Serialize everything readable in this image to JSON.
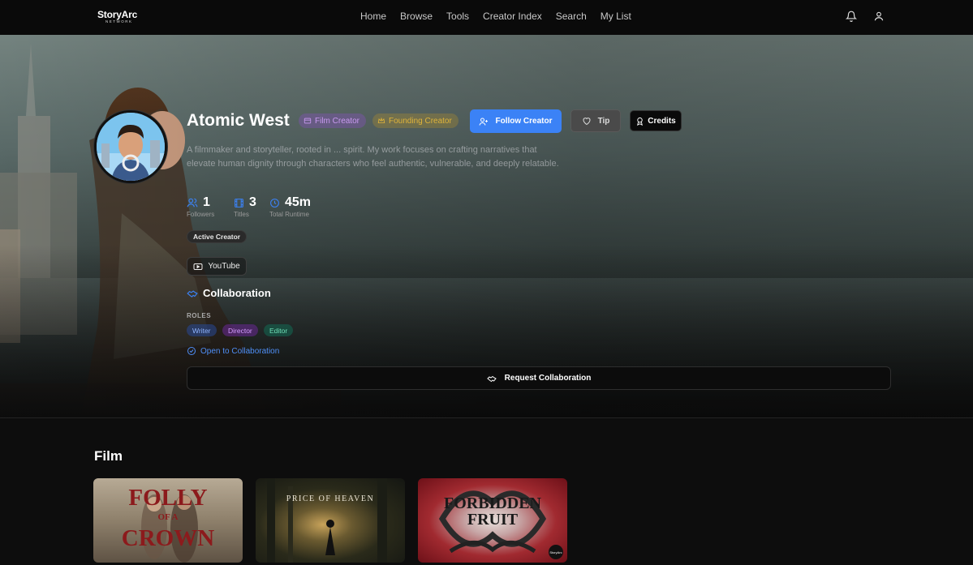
{
  "nav": {
    "logo_main": "StoryArc",
    "logo_sub": "NETWORK",
    "links": [
      "Home",
      "Browse",
      "Tools",
      "Creator Index",
      "Search",
      "My List"
    ]
  },
  "profile": {
    "name": "Atomic West",
    "badges": {
      "film": "Film Creator",
      "founding": "Founding Creator"
    },
    "buttons": {
      "follow": "Follow Creator",
      "tip": "Tip",
      "credits": "Credits"
    },
    "bio": "A filmmaker and storyteller, rooted in ... spirit. My work focuses on crafting narratives that elevate human dignity through characters who feel authentic, vulnerable, and deeply relatable.",
    "stats": [
      {
        "value": "1",
        "label": "Followers"
      },
      {
        "value": "3",
        "label": "Titles"
      },
      {
        "value": "45m",
        "label": "Total Runtime"
      }
    ],
    "status_badge": "Active Creator",
    "social": {
      "youtube": "YouTube"
    }
  },
  "collaboration": {
    "title": "Collaboration",
    "roles_label": "ROLES",
    "roles": [
      "Writer",
      "Director",
      "Editor"
    ],
    "open_text": "Open to Collaboration",
    "request_button": "Request Collaboration"
  },
  "film_section": {
    "heading": "Film",
    "cards": [
      {
        "title_line1": "FOLLY",
        "title_line2": "OF A",
        "title_line3": "CROWN"
      },
      {
        "title": "PRICE OF HEAVEN"
      },
      {
        "title_line1": "FORBIDDEN",
        "title_line2": "FRUIT",
        "corner_badge": "StoryArc"
      }
    ]
  },
  "colors": {
    "accent": "#3b82f6",
    "founding_gold": "#e0b43a",
    "film_purple": "#c99af0",
    "background": "#0d0d0d"
  }
}
